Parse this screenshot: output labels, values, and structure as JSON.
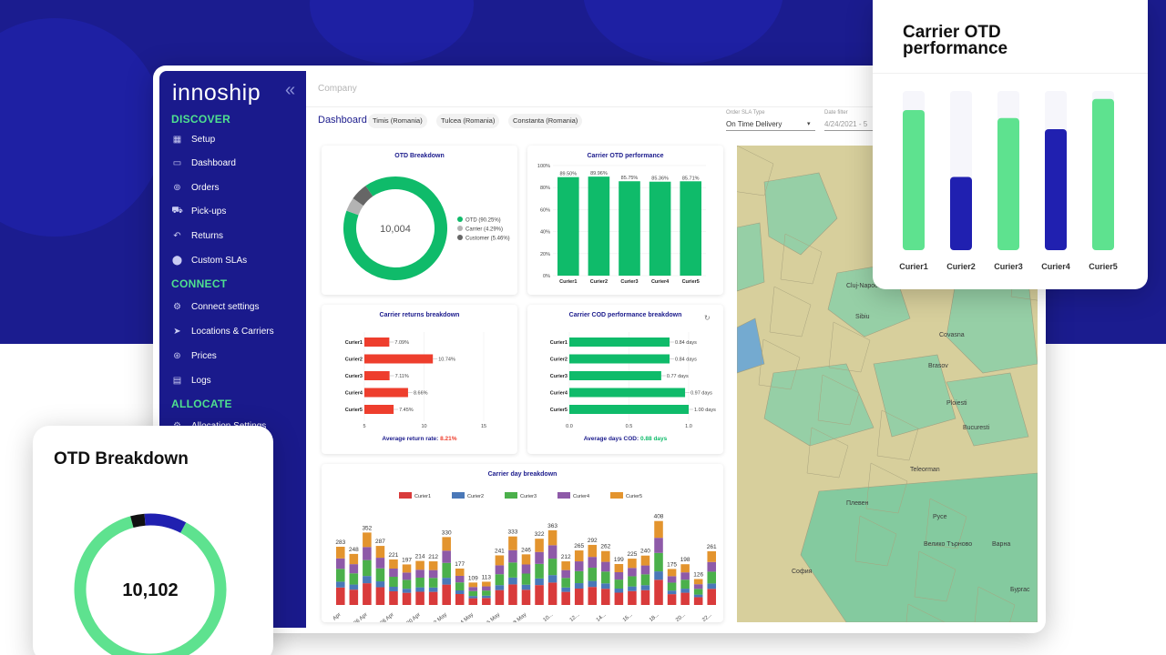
{
  "app": {
    "logo": "innoship",
    "company_placeholder": "Company",
    "dashboard_label": "Dashboard",
    "region_chips": [
      "Timis (Romania)",
      "Tulcea (Romania)",
      "Constanta (Romania)"
    ],
    "order_sla": {
      "label": "Order SLA Type",
      "value": "On Time Delivery"
    },
    "date_filter": {
      "label": "Date filter",
      "value": "4/24/2021 - 5"
    }
  },
  "sidebar": {
    "sections": {
      "discover": "DISCOVER",
      "connect": "CONNECT",
      "allocate": "ALLOCATE"
    },
    "discover_items": [
      {
        "label": "Setup",
        "icon": "grid-icon"
      },
      {
        "label": "Dashboard",
        "icon": "monitor-icon"
      },
      {
        "label": "Orders",
        "icon": "orders-icon"
      },
      {
        "label": "Pick-ups",
        "icon": "truck-icon"
      },
      {
        "label": "Returns",
        "icon": "return-icon"
      },
      {
        "label": "Custom SLAs",
        "icon": "pin-icon"
      }
    ],
    "connect_items": [
      {
        "label": "Connect settings",
        "icon": "settings-icon"
      },
      {
        "label": "Locations & Carriers",
        "icon": "send-icon"
      },
      {
        "label": "Prices",
        "icon": "price-tag-icon"
      },
      {
        "label": "Logs",
        "icon": "logs-icon"
      }
    ],
    "allocate_items": [
      {
        "label": "Allocation Settings",
        "icon": "settings-icon"
      }
    ]
  },
  "chart_data": [
    {
      "id": "otd-breakdown",
      "type": "pie",
      "title": "OTD Breakdown",
      "center_value": "10,004",
      "slices": [
        {
          "label": "OTD (90.25%)",
          "value": 90.25,
          "color": "#0fbb6a"
        },
        {
          "label": "Carrier (4.29%)",
          "value": 4.29,
          "color": "#b3b3b3"
        },
        {
          "label": "Customer (5.46%)",
          "value": 5.46,
          "color": "#666666"
        }
      ]
    },
    {
      "id": "carrier-otd-performance",
      "type": "bar",
      "title": "Carrier OTD performance",
      "categories": [
        "Curier1",
        "Curier2",
        "Curier3",
        "Curier4",
        "Curier5"
      ],
      "values": [
        89.5,
        89.96,
        85.75,
        85.36,
        85.71
      ],
      "value_labels": [
        "89.50%",
        "89.96%",
        "85.75%",
        "85.36%",
        "85.71%"
      ],
      "yticks": [
        "0%",
        "20%",
        "40%",
        "60%",
        "80%",
        "100%"
      ],
      "ylim": [
        0,
        100
      ],
      "color": "#0fbb6a"
    },
    {
      "id": "carrier-returns-breakdown",
      "type": "bar",
      "orientation": "horizontal",
      "title": "Carrier returns breakdown",
      "categories": [
        "Curier1",
        "Curier2",
        "Curier3",
        "Curier4",
        "Curier5"
      ],
      "values": [
        7.09,
        10.74,
        7.11,
        8.66,
        7.45
      ],
      "value_labels": [
        "7.09%",
        "10.74%",
        "7.11%",
        "8.66%",
        "7.45%"
      ],
      "xticks": [
        "5",
        "10",
        "15"
      ],
      "xlim": [
        5,
        15
      ],
      "footer_label": "Average return rate:",
      "footer_value": "8.21%",
      "color": "#ee3e2d"
    },
    {
      "id": "carrier-cod-performance",
      "type": "bar",
      "orientation": "horizontal",
      "title": "Carrier COD performance breakdown",
      "categories": [
        "Curier1",
        "Curier2",
        "Curier3",
        "Curier4",
        "Curier5"
      ],
      "values": [
        0.84,
        0.84,
        0.77,
        0.97,
        1.0
      ],
      "value_labels": [
        "0.84 days",
        "0.84 days",
        "0.77 days",
        "0.97 days",
        "1.00 days"
      ],
      "xticks": [
        "0.0",
        "0.5",
        "1.0"
      ],
      "xlim": [
        0,
        1
      ],
      "footer_label": "Average days COD:",
      "footer_value": "0.88 days",
      "color": "#0fbb6a"
    },
    {
      "id": "carrier-day-breakdown",
      "type": "bar",
      "stacked": true,
      "title": "Carrier day breakdown",
      "legend": [
        {
          "name": "Curier1",
          "color": "#d93b3b"
        },
        {
          "name": "Curier2",
          "color": "#4a78b8"
        },
        {
          "name": "Curier3",
          "color": "#4bb04b"
        },
        {
          "name": "Curier4",
          "color": "#8e5aa8"
        },
        {
          "name": "Curier5",
          "color": "#e3942e"
        }
      ],
      "totals": [
        283,
        248,
        352,
        287,
        221,
        197,
        214,
        212,
        330,
        177,
        109,
        113,
        241,
        333,
        246,
        322,
        363,
        212,
        265,
        292,
        262,
        199,
        225,
        240,
        408,
        175,
        198,
        126,
        261
      ],
      "x_tick_labels": [
        "Apr",
        "26 Apr",
        "28 Apr",
        "30 Apr",
        "2 May",
        "4 May",
        "6 May",
        "8 May",
        "10...",
        "12...",
        "14...",
        "16...",
        "18...",
        "20...",
        "22..."
      ]
    },
    {
      "id": "overlay-carrier-otd",
      "type": "bar",
      "title": "Carrier OTD performance",
      "categories": [
        "Curier1",
        "Curier2",
        "Curier3",
        "Curier4",
        "Curier5"
      ],
      "values": [
        88,
        46,
        83,
        76,
        95
      ],
      "ylim": [
        0,
        100
      ],
      "colors": [
        "#5ee28f",
        "#2020b0",
        "#5ee28f",
        "#2020b0",
        "#5ee28f"
      ]
    },
    {
      "id": "overlay-otd-breakdown",
      "type": "pie",
      "title": "OTD Breakdown",
      "center_value": "10,102",
      "slices": [
        {
          "label": "OTD",
          "value": 88,
          "color": "#5ee28f"
        },
        {
          "label": "Carrier",
          "value": 9,
          "color": "#2020b0"
        },
        {
          "label": "Customer",
          "value": 3,
          "color": "#111111"
        }
      ]
    }
  ],
  "map": {
    "labels": [
      "Cluj-Napoca",
      "Brasov",
      "Ploiesti",
      "Bucuresti",
      "Covasna",
      "Sibiu",
      "Teleorman",
      "Плевен",
      "София",
      "Велико Търново",
      "Русе",
      "Варна",
      "Бургас"
    ]
  }
}
